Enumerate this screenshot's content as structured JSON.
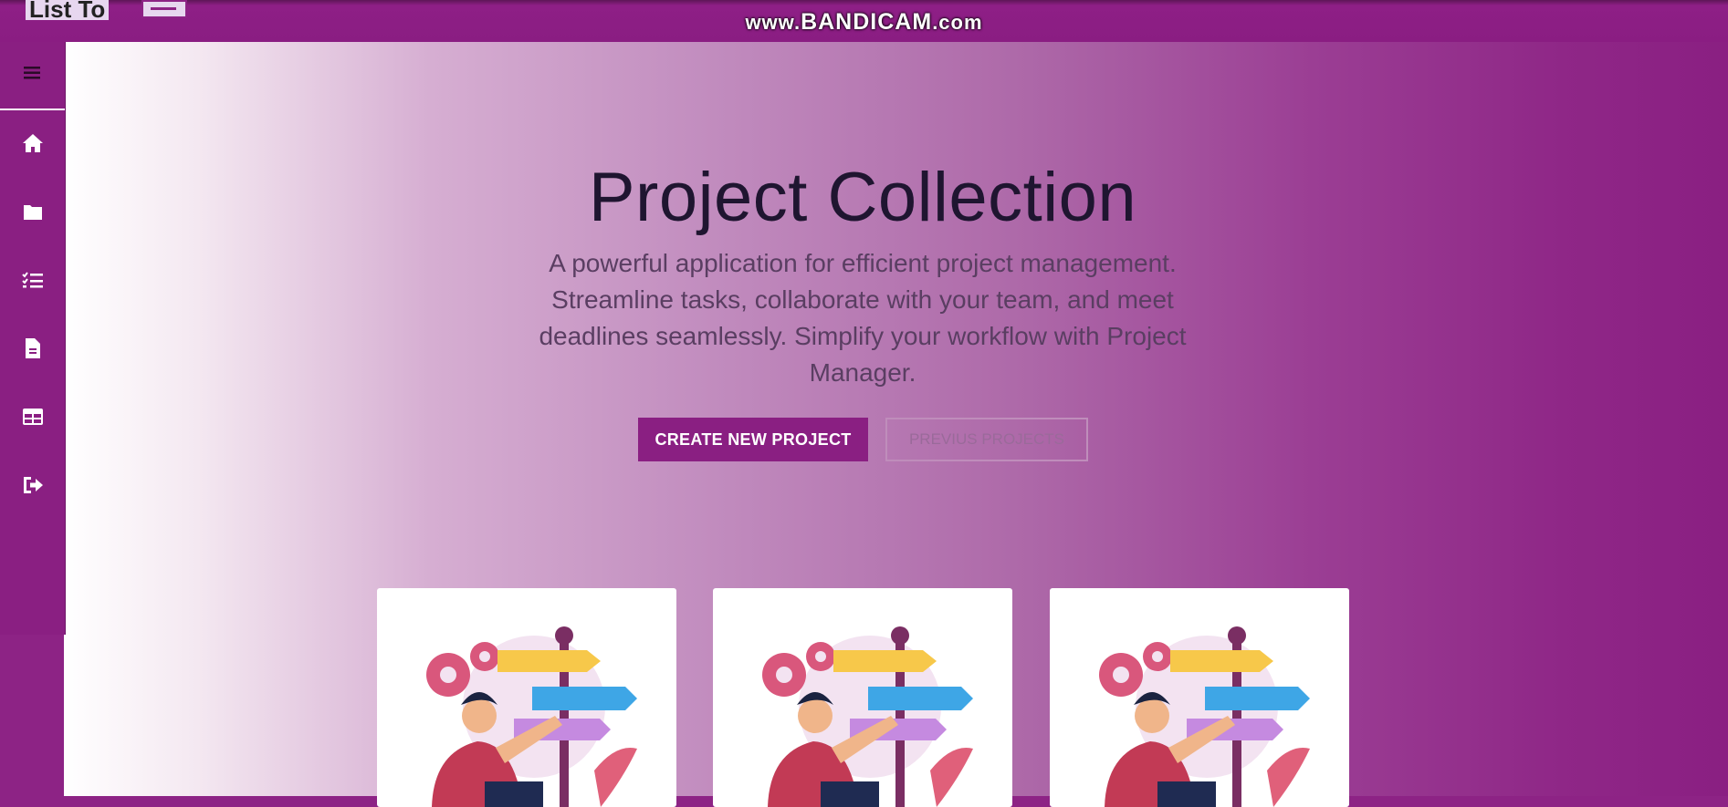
{
  "topbar": {
    "brand_text": "List To",
    "watermark_prefix": "www.",
    "watermark_main": "BANDICAM",
    "watermark_suffix": ".com"
  },
  "sidebar": {
    "items": [
      {
        "name": "menu",
        "icon": "hamburger-icon"
      },
      {
        "name": "home",
        "icon": "home-icon"
      },
      {
        "name": "projects",
        "icon": "folder-icon"
      },
      {
        "name": "tasks",
        "icon": "checklist-icon"
      },
      {
        "name": "documents",
        "icon": "file-icon"
      },
      {
        "name": "table",
        "icon": "table-icon"
      },
      {
        "name": "logout",
        "icon": "logout-icon"
      }
    ]
  },
  "hero": {
    "title": "Project Collection",
    "description": "A powerful application for efficient project management. Streamline tasks, collaborate with your team, and meet deadlines seamlessly. Simplify your workflow with Project Manager.",
    "primary_button": "CREATE NEW PROJECT",
    "secondary_button": "PREVIUS PROJECTS"
  },
  "cards": [
    {
      "illustration": "signpost-illustration"
    },
    {
      "illustration": "signpost-illustration"
    },
    {
      "illustration": "signpost-illustration"
    }
  ],
  "colors": {
    "accent": "#8a1f82",
    "title": "#1f1530",
    "text": "#5a3e62"
  }
}
